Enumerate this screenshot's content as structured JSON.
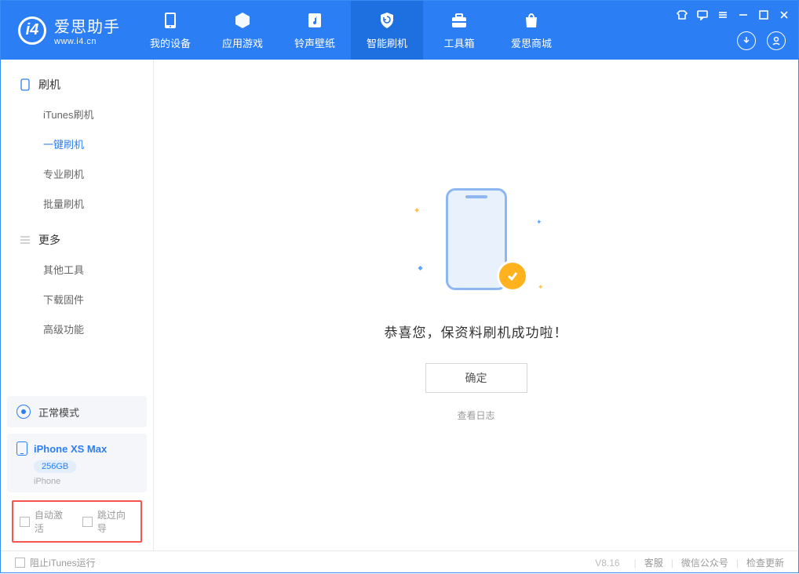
{
  "app": {
    "name_cn": "爱思助手",
    "url": "www.i4.cn"
  },
  "nav": {
    "items": [
      {
        "label": "我的设备"
      },
      {
        "label": "应用游戏"
      },
      {
        "label": "铃声壁纸"
      },
      {
        "label": "智能刷机"
      },
      {
        "label": "工具箱"
      },
      {
        "label": "爱思商城"
      }
    ]
  },
  "sidebar": {
    "group1_label": "刷机",
    "group1_items": [
      {
        "label": "iTunes刷机"
      },
      {
        "label": "一键刷机"
      },
      {
        "label": "专业刷机"
      },
      {
        "label": "批量刷机"
      }
    ],
    "group2_label": "更多",
    "group2_items": [
      {
        "label": "其他工具"
      },
      {
        "label": "下载固件"
      },
      {
        "label": "高级功能"
      }
    ],
    "mode_label": "正常模式",
    "device_name": "iPhone XS Max",
    "device_storage": "256GB",
    "device_type": "iPhone",
    "cb_auto_activate": "自动激活",
    "cb_skip_guide": "跳过向导"
  },
  "main": {
    "success_text": "恭喜您，保资料刷机成功啦！",
    "ok_label": "确定",
    "view_log_label": "查看日志"
  },
  "footer": {
    "cb_block_itunes": "阻止iTunes运行",
    "version": "V8.16",
    "link_support": "客服",
    "link_wechat": "微信公众号",
    "link_update": "检查更新"
  }
}
